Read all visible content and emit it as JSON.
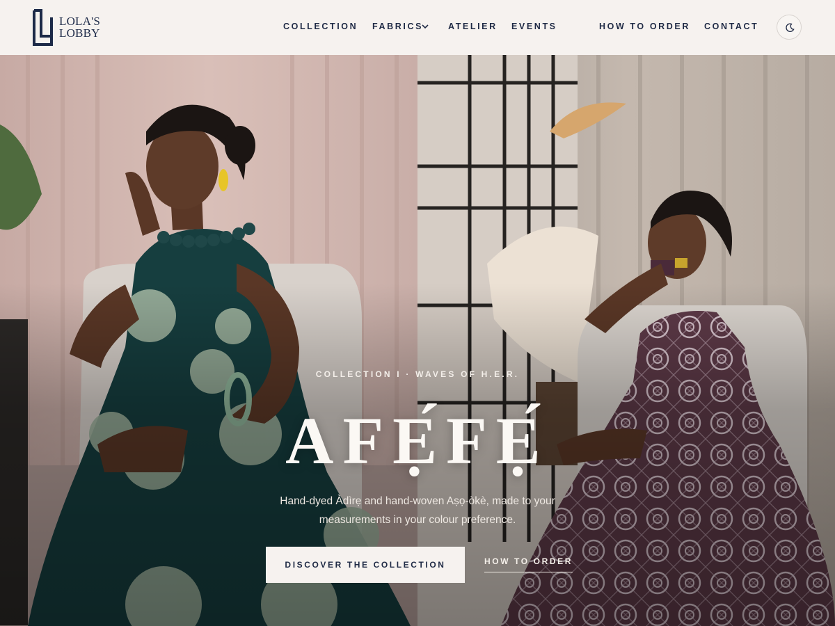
{
  "brand": {
    "line1": "LOLA'S",
    "line2": "LOBBY"
  },
  "nav": {
    "collection": "COLLECTION",
    "fabrics": "FABRICS",
    "atelier": "ATELIER",
    "events": "EVENTS",
    "how_to_order": "HOW TO ORDER",
    "contact": "CONTACT"
  },
  "hero": {
    "eyebrow": "COLLECTION I · WAVES OF H.E.R.",
    "title": "AFẸ́FẸ́",
    "subtitle": "Hand-dyed Àdìrẹ and hand-woven Aṣọ-òkè, made to your measurements in your colour preference.",
    "primary_cta": "DISCOVER THE COLLECTION",
    "secondary_cta": "HOW TO ORDER"
  },
  "colors": {
    "navy": "#1d2a48",
    "cream": "#f6f2ef",
    "teal_dress": "#163e3f",
    "plum_dress": "#5e3a48"
  },
  "icons": {
    "theme_toggle": "moon-icon",
    "fabrics_dropdown": "chevron-down-icon"
  }
}
